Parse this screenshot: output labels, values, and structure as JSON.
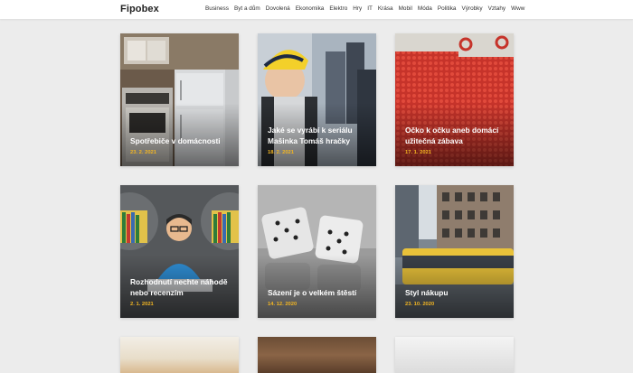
{
  "site": {
    "logo": "Fipobex"
  },
  "nav": [
    "Business",
    "Byt a dům",
    "Dovolená",
    "Ekonomika",
    "Elektro",
    "Hry",
    "IT",
    "Krása",
    "Mobil",
    "Móda",
    "Politika",
    "Výrobky",
    "Vztahy",
    "Www"
  ],
  "articles": [
    {
      "title": "Spotřebiče v domácnosti",
      "date": "23. 2. 2021"
    },
    {
      "title": "Jaké se vyrábí k seriálu Mašinka Tomáš hračky",
      "date": "18. 2. 2021"
    },
    {
      "title": "Očko k očku aneb domácí užitečná zábava",
      "date": "17. 1. 2021"
    },
    {
      "title": "Rozhodnutí nechte náhodě nebo recenzím",
      "date": "2. 1. 2021"
    },
    {
      "title": "Sázení je o velkém štěstí",
      "date": "14. 12. 2020"
    },
    {
      "title": "Styl nákupu",
      "date": "23. 10. 2020"
    }
  ]
}
